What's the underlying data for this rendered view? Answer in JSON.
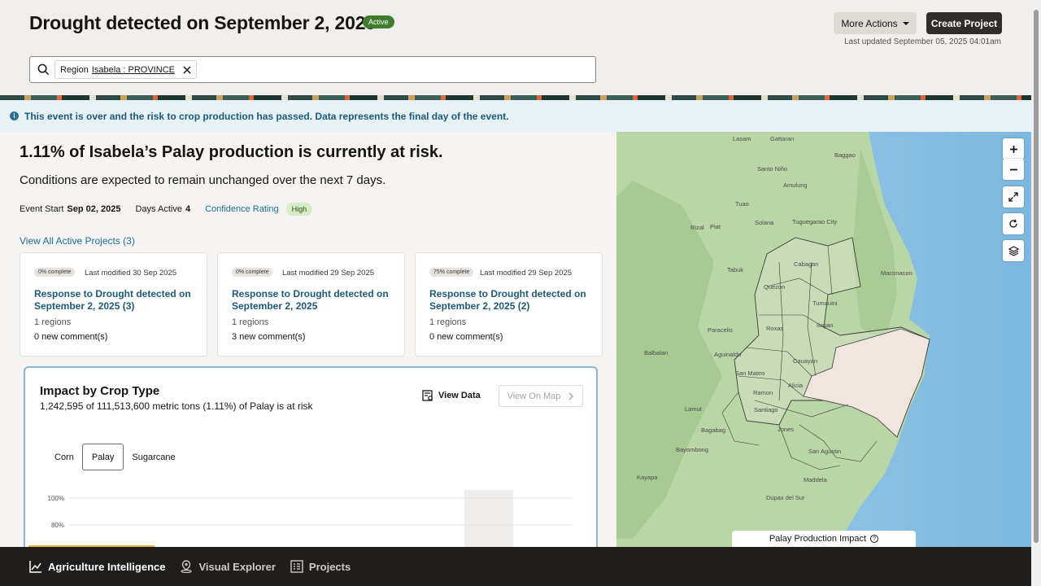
{
  "header": {
    "title": "Drought detected on September 2, 2025",
    "status_badge": "Active",
    "more_actions_label": "More Actions",
    "create_project_label": "Create Project",
    "last_updated": "Last updated September 05, 2025 04:01am"
  },
  "search": {
    "chip_label": "Region",
    "chip_value": "Isabela : PROVINCE"
  },
  "info_banner": "This event is over and the risk to crop production has passed. Data represents the final day of the event.",
  "summary": {
    "heading": "1.11% of Isabela’s Palay production is currently at risk.",
    "subheading": "Conditions are expected to remain unchanged over the next 7 days.",
    "event_start_label": "Event Start",
    "event_start_value": "Sep 02, 2025",
    "days_active_label": "Days Active",
    "days_active_value": "4",
    "confidence_label": "Confidence Rating",
    "confidence_value": "High",
    "view_all_projects": "View All Active Projects (3)"
  },
  "projects": [
    {
      "progress": "0% complete",
      "modified": "Last modified 30 Sep 2025",
      "title": "Response to Drought detected on September 2, 2025 (3)",
      "regions": "1 regions",
      "comments": "0 new comment(s)"
    },
    {
      "progress": "0% complete",
      "modified": "Last modified 29 Sep 2025",
      "title": "Response to Drought detected on September 2, 2025",
      "regions": "1 regions",
      "comments": "3 new comment(s)"
    },
    {
      "progress": "75% complete",
      "modified": "Last modified 29 Sep 2025",
      "title": "Response to Drought detected on September 2, 2025 (2)",
      "regions": "1 regions",
      "comments": "0 new comment(s)"
    }
  ],
  "impact": {
    "title": "Impact by Crop Type",
    "subtitle": "1,242,595 of 111,513,600 metric tons (1.11%) of Palay is at risk",
    "view_data_label": "View Data",
    "view_on_map_label": "View On Map",
    "tabs": [
      "Corn",
      "Palay",
      "Sugarcane"
    ],
    "selected_tab": "Palay",
    "y_ticks": [
      "100%",
      "80%"
    ]
  },
  "map": {
    "legend_label": "Palay Production Impact",
    "places": [
      "Lasam",
      "Gattaran",
      "Baggao",
      "Santo Niño",
      "Amulung",
      "Tuao",
      "Solana",
      "Tuguegarao City",
      "Piat",
      "Rizal",
      "Tabuk",
      "Cabagan",
      "Quezon",
      "Tumauini",
      "Maconacon",
      "Ilagan",
      "Roxas",
      "Paracelis",
      "Balbalan",
      "Aguinaldo",
      "Cauayan",
      "San Mateo",
      "Alicia",
      "Ramon",
      "Lamut",
      "Santiago",
      "Jones",
      "Bagabag",
      "Bayombong",
      "San Agustin",
      "Kayapa",
      "Dupax del Sur",
      "Maddela"
    ]
  },
  "nav": {
    "items": [
      "Agriculture Intelligence",
      "Visual Explorer",
      "Projects"
    ],
    "active": "Agriculture Intelligence"
  },
  "colors": {
    "accent_link": "#1f6f8f",
    "active_badge": "#3f7d2c",
    "high_badge": "#d7edc7",
    "nav_bg": "#201e1c"
  }
}
